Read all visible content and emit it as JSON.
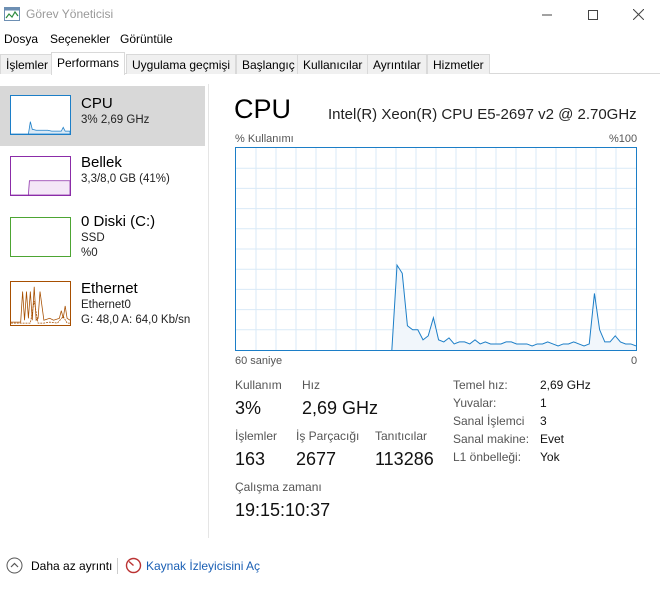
{
  "window": {
    "title": "Görev Yöneticisi"
  },
  "menu": {
    "items": [
      "Dosya",
      "Seçenekler",
      "Görüntüle"
    ]
  },
  "tabs": [
    "İşlemler",
    "Performans",
    "Uygulama geçmişi",
    "Başlangıç",
    "Kullanıcılar",
    "Ayrıntılar",
    "Hizmetler"
  ],
  "active_tab": "Performans",
  "sidebar": {
    "items": [
      {
        "title": "CPU",
        "sub1": "3% 2,69 GHz",
        "sub2": "",
        "color": "#1c7ec7"
      },
      {
        "title": "Bellek",
        "sub1": "3,3/8,0 GB (41%)",
        "sub2": "",
        "color": "#8b2ca8"
      },
      {
        "title": "0 Diski (C:)",
        "sub1": "SSD",
        "sub2": "%0",
        "color": "#4da533"
      },
      {
        "title": "Ethernet",
        "sub1": "Ethernet0",
        "sub2_g": "G: 48,0",
        "sub2_a": "A: 64,0 Kb/sn",
        "color": "#a74f01"
      }
    ]
  },
  "main": {
    "title": "CPU",
    "model": "Intel(R) Xeon(R) CPU E5-2697 v2 @ 2.70GHz",
    "graph_label_left": "% Kullanımı",
    "graph_label_right": "%100",
    "graph_footer_left": "60 saniye",
    "graph_footer_right": "0",
    "utilization": [
      0,
      0,
      0,
      0,
      0,
      0,
      0,
      0,
      0,
      0,
      0,
      0,
      0,
      0,
      0,
      0,
      0,
      0,
      0,
      0,
      0,
      0,
      0,
      0,
      0,
      0,
      0,
      0,
      0,
      0,
      0,
      42,
      38,
      12,
      10,
      10,
      5,
      7,
      16,
      5,
      4,
      6,
      3,
      4,
      4,
      3,
      5,
      3,
      4,
      3,
      3,
      3,
      4,
      4,
      3,
      3,
      3,
      2,
      3,
      3,
      4,
      3,
      2,
      3,
      3,
      4,
      3,
      2,
      3,
      28,
      10,
      4,
      4,
      7,
      4,
      3,
      3,
      2
    ]
  },
  "stats": {
    "utilization_label": "Kullanım",
    "utilization_value": "3%",
    "speed_label": "Hız",
    "speed_value": "2,69 GHz",
    "processes_label": "İşlemler",
    "processes_value": "163",
    "threads_label": "İş Parçacığı",
    "threads_value": "2677",
    "handles_label": "Tanıtıcılar",
    "handles_value": "113286",
    "uptime_label": "Çalışma zamanı",
    "uptime_value": "19:15:10:37"
  },
  "details": [
    {
      "label": "Temel hız:",
      "value": "2,69 GHz"
    },
    {
      "label": "Yuvalar:",
      "value": "1"
    },
    {
      "label": "Sanal İşlemci",
      "value": "3"
    },
    {
      "label": "Sanal makine:",
      "value": "Evet"
    },
    {
      "label": "L1 önbelleği:",
      "value": "Yok"
    }
  ],
  "footer": {
    "fewer_details": "Daha az ayrıntı",
    "resource_monitor": "Kaynak İzleyicisini Aç"
  }
}
